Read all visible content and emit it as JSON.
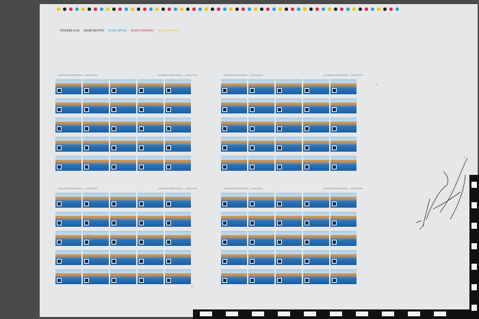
{
  "register_dots": [
    "#f2c500",
    "#1b1b1b",
    "#e0204a",
    "#1ba3d8",
    "#f2c500",
    "#1b1b1b",
    "#e0204a",
    "#1ba3d8",
    "#f2c500",
    "#1b1b1b",
    "#e0204a",
    "#1ba3d8",
    "#f2c500",
    "#1b1b1b",
    "#e0204a",
    "#1ba3d8",
    "#f2c500",
    "#1b1b1b",
    "#e0204a",
    "#1ba3d8",
    "#f2c500",
    "#1b1b1b",
    "#e0204a",
    "#1ba3d8",
    "#f2c500",
    "#1b1b1b",
    "#e0204a",
    "#1ba3d8",
    "#f2c500",
    "#1b1b1b",
    "#e0204a",
    "#1ba3d8",
    "#f2c500",
    "#1b1b1b",
    "#e0204a",
    "#1ba3d8",
    "#f2c500",
    "#1b1b1b",
    "#e0204a",
    "#1ba3d8",
    "#f2c500",
    "#1b1b1b",
    "#e0204a",
    "#1ba3d8",
    "#f2c500",
    "#1b1b1b",
    "#e0204a",
    "#1ba3d8",
    "#f2c500",
    "#1b1b1b",
    "#e0204a",
    "#1ba3d8",
    "#f2c500",
    "#1b1b1b",
    "#e0204a",
    "#1ba3d8"
  ],
  "legend": [
    {
      "text": "ΠΟΚΣΕΣ 6.01",
      "color": "#1b1b1b"
    },
    {
      "text": "32180 ΜΑΥΡΟ",
      "color": "#1b1b1b"
    },
    {
      "text": "32180 ΜΠΛΕ",
      "color": "#1ba3d8"
    },
    {
      "text": "32180 ΚΟΚΚΙΝΟ",
      "color": "#e0204a"
    },
    {
      "text": "32180 ΚΙΤΡΙΝΟ",
      "color": "#f2c500"
    }
  ],
  "pane_caption": "ΕΛΛΗΝΙΚΗ ΔΗΜΟΚΡΑΤΙΑ — ΚΑΤΑΛΟΓΟΣ",
  "pane_grid": {
    "rows": 5,
    "cols": 5
  },
  "signature": "signature",
  "corner_note": "0000"
}
